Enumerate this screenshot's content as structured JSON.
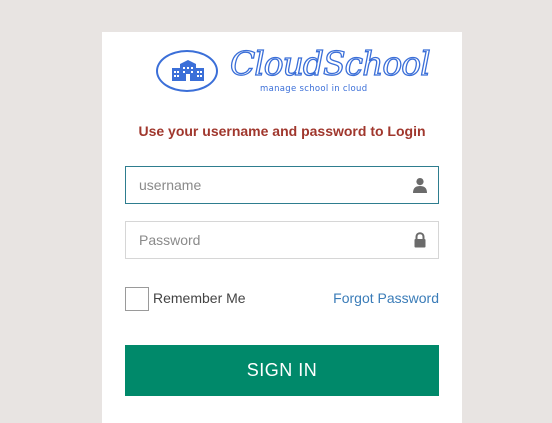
{
  "logo": {
    "title": "CloudSchool",
    "subtitle": "manage school in cloud",
    "icon": "school-building-icon",
    "color": "#3b6fd8"
  },
  "headline": "Use your username and password to Login",
  "username_field": {
    "placeholder": "username",
    "value": "",
    "icon": "user-icon"
  },
  "password_field": {
    "placeholder": "Password",
    "value": "",
    "icon": "lock-icon"
  },
  "remember_me": {
    "label": "Remember Me",
    "checked": false
  },
  "forgot_password_label": "Forgot Password",
  "sign_in_label": "SIGN IN",
  "colors": {
    "page_background": "#e8e4e2",
    "headline": "#a0372d",
    "link": "#3a7cb8",
    "button": "#00896a",
    "focus_border": "#2e7d8f"
  }
}
